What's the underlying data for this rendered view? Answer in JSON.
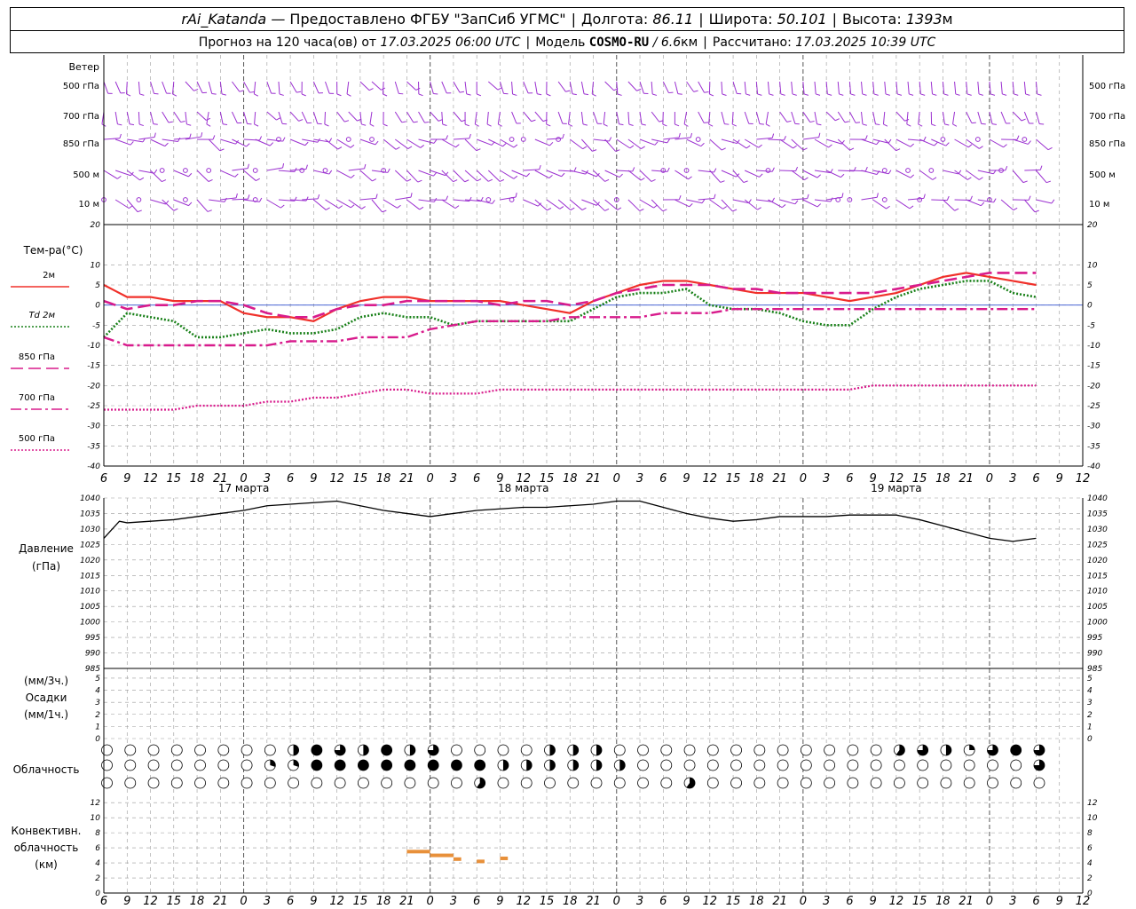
{
  "header": {
    "station": "rAi_Katanda",
    "provider": "— Предоставлено ФГБУ \"ЗапСиб УГМС\"",
    "lon_label": "Долгота:",
    "lon": "86.11",
    "lat_label": "Широта:",
    "lat": "50.101",
    "alt_label": "Высота:",
    "alt": "1393",
    "alt_unit": "м",
    "forecast_label": "Прогноз на 120 часа(ов) от",
    "forecast_start": "17.03.2025 06:00 UTC",
    "model_label": "Модель",
    "model": "COSMO-RU",
    "resolution": "/ 6.6",
    "resolution_unit": "км",
    "calc_label": "Рассчитано:",
    "calc_time": "17.03.2025 10:39 UTC"
  },
  "wind_panel": {
    "title": "Ветер",
    "levels": [
      "500 гПа",
      "700 гПа",
      "850 гПа",
      "500 м",
      "10 м"
    ]
  },
  "labels": {
    "temp_title": "Тем-ра(°C)",
    "legend": [
      {
        "label": "2м",
        "color": "#f0302a",
        "style": "solid"
      },
      {
        "label": "Td 2м",
        "color": "#188018",
        "style": "dotted"
      },
      {
        "label": "850 гПа",
        "color": "#d81b8c",
        "style": "dash"
      },
      {
        "label": "700 гПа",
        "color": "#d81b8c",
        "style": "dashdot"
      },
      {
        "label": "500 гПа",
        "color": "#d81b8c",
        "style": "dot"
      }
    ],
    "pressure_title": "Давление",
    "pressure_unit": "(гПа)",
    "precip_unit1": "(мм/3ч.)",
    "precip_title": "Осадки",
    "precip_unit2": "(мм/1ч.)",
    "cloud_title": "Облачность",
    "conv_title1": "Конвективн.",
    "conv_title2": "облачность",
    "conv_unit": "(км)"
  },
  "chart_data": [
    {
      "type": "line",
      "name": "temperature",
      "ylim": [
        -40,
        20
      ],
      "yticks": [
        "20",
        "10",
        "5",
        "0",
        "-5",
        "-10",
        "-15",
        "-20",
        "-25",
        "-30",
        "-35",
        "-40"
      ],
      "x_hours": [
        0,
        3,
        6,
        9,
        12,
        15,
        18,
        21,
        24,
        27,
        30,
        33,
        36,
        39,
        42,
        45,
        48,
        51,
        54,
        57,
        60,
        63,
        66,
        69,
        72,
        75,
        78,
        81,
        84,
        87,
        90,
        93,
        96,
        99,
        102,
        105,
        108,
        111,
        114,
        117,
        120
      ],
      "series": [
        {
          "name": "2м",
          "values": [
            5,
            2,
            2,
            1,
            1,
            1,
            -2,
            -3,
            -3,
            -4,
            -1,
            1,
            2,
            2,
            1,
            1,
            1,
            1,
            0,
            -1,
            -2,
            1,
            3,
            5,
            6,
            6,
            5,
            4,
            3,
            3,
            3,
            2,
            1,
            2,
            3,
            5,
            7,
            8,
            7,
            6,
            5
          ]
        },
        {
          "name": "Td 2м",
          "values": [
            -8,
            -2,
            -3,
            -4,
            -8,
            -8,
            -7,
            -6,
            -7,
            -7,
            -6,
            -3,
            -2,
            -3,
            -3,
            -5,
            -4,
            -4,
            -4,
            -4,
            -4,
            -1,
            2,
            3,
            3,
            4,
            0,
            -1,
            -1,
            -2,
            -4,
            -5,
            -5,
            -1,
            2,
            4,
            5,
            6,
            6,
            3,
            2
          ]
        },
        {
          "name": "850 гПа",
          "values": [
            1,
            -1,
            0,
            0,
            1,
            1,
            0,
            -2,
            -3,
            -3,
            -1,
            0,
            0,
            1,
            1,
            1,
            1,
            0,
            1,
            1,
            0,
            1,
            3,
            4,
            5,
            5,
            5,
            4,
            4,
            3,
            3,
            3,
            3,
            3,
            4,
            5,
            6,
            7,
            8,
            8,
            8
          ]
        },
        {
          "name": "700 гПа",
          "values": [
            -8,
            -10,
            -10,
            -10,
            -10,
            -10,
            -10,
            -10,
            -9,
            -9,
            -9,
            -8,
            -8,
            -8,
            -6,
            -5,
            -4,
            -4,
            -4,
            -4,
            -3,
            -3,
            -3,
            -3,
            -2,
            -2,
            -2,
            -1,
            -1,
            -1,
            -1,
            -1,
            -1,
            -1,
            -1,
            -1,
            -1,
            -1,
            -1,
            -1,
            -1
          ]
        },
        {
          "name": "500 гПа",
          "values": [
            -26,
            -26,
            -26,
            -26,
            -25,
            -25,
            -25,
            -24,
            -24,
            -23,
            -23,
            -22,
            -21,
            -21,
            -22,
            -22,
            -22,
            -21,
            -21,
            -21,
            -21,
            -21,
            -21,
            -21,
            -21,
            -21,
            -21,
            -21,
            -21,
            -21,
            -21,
            -21,
            -21,
            -20,
            -20,
            -20,
            -20,
            -20,
            -20,
            -20,
            -20
          ]
        }
      ]
    },
    {
      "type": "line",
      "name": "pressure",
      "ylim": [
        985,
        1040
      ],
      "yticks": [
        "1040",
        "1035",
        "1030",
        "1025",
        "1020",
        "1015",
        "1010",
        "1005",
        "1000",
        "995",
        "990",
        "985"
      ],
      "x_hours": [
        0,
        2,
        3,
        6,
        9,
        12,
        15,
        18,
        21,
        24,
        27,
        30,
        33,
        36,
        39,
        42,
        45,
        48,
        51,
        54,
        57,
        60,
        63,
        66,
        69,
        72,
        75,
        78,
        81,
        84,
        87,
        90,
        93,
        96,
        99,
        102,
        105,
        108,
        111,
        114,
        117,
        120
      ],
      "series": [
        {
          "name": "pressure",
          "values": [
            1027,
            1032.5,
            1032,
            1032.5,
            1033,
            1034,
            1035,
            1036,
            1037.5,
            1038,
            1038.5,
            1039,
            1037.5,
            1036,
            1035,
            1034,
            1035,
            1036,
            1036.5,
            1037,
            1037,
            1037.5,
            1038,
            1039,
            1039,
            1037,
            1035,
            1033.5,
            1032.5,
            1033,
            1034,
            1034,
            1034,
            1034.5,
            1034.5,
            1034.5,
            1033,
            1031,
            1029,
            1027,
            1026,
            1027
          ]
        }
      ]
    },
    {
      "type": "scatter",
      "name": "precipitation",
      "ylim": [
        0,
        5
      ],
      "yticks": [
        "5",
        "4",
        "3",
        "2",
        "1",
        "0"
      ],
      "values": []
    },
    {
      "type": "heatmap",
      "name": "cloudiness",
      "rows": [
        "upper",
        "middle",
        "lower"
      ],
      "count_per_row": 41
    },
    {
      "type": "bar",
      "name": "convective cloudiness",
      "ylim": [
        0,
        12
      ],
      "yticks": [
        "12",
        "10",
        "8",
        "6",
        "4",
        "2",
        "0"
      ],
      "segments": [
        {
          "from_hour": 39,
          "to_hour": 42,
          "top_km": 5.5
        },
        {
          "from_hour": 42,
          "to_hour": 45,
          "top_km": 5.0
        },
        {
          "from_hour": 45,
          "to_hour": 46,
          "top_km": 4.5
        },
        {
          "from_hour": 48,
          "to_hour": 49,
          "top_km": 4.2
        },
        {
          "from_hour": 51,
          "to_hour": 52,
          "top_km": 4.6
        }
      ]
    }
  ],
  "time_axis": {
    "ticks": [
      "6",
      "9",
      "12",
      "15",
      "18",
      "21",
      "0",
      "3",
      "6",
      "9",
      "12",
      "15",
      "18",
      "21",
      "0",
      "3",
      "6",
      "9",
      "12",
      "15",
      "18",
      "21",
      "0",
      "3",
      "6",
      "9",
      "12",
      "15",
      "18",
      "21",
      "0",
      "3",
      "6",
      "9",
      "12",
      "15",
      "18",
      "21",
      "0",
      "3",
      "6",
      "9",
      "12"
    ],
    "days": [
      "17 марта",
      "18 марта",
      "19 марта"
    ]
  },
  "colors": {
    "wind": "#9b30d0",
    "t2m": "#f0302a",
    "td2m": "#188018",
    "magenta": "#d81b8c",
    "conv": "#e8903a",
    "grid": "#999999"
  }
}
